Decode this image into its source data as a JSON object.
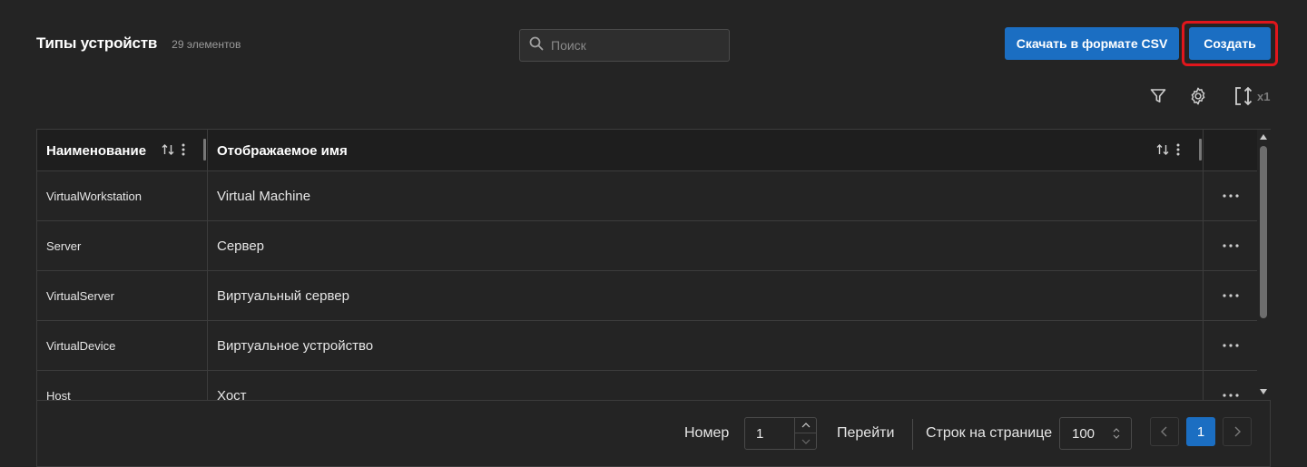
{
  "header": {
    "title": "Типы устройств",
    "count": "29 элементов",
    "search_placeholder": "Поиск",
    "csv_button": "Скачать в формате CSV",
    "create_button": "Создать"
  },
  "toolbar": {
    "filter_icon": "filter-icon",
    "settings_icon": "gear-icon",
    "density_icon": "row-height-icon",
    "density_label": "x1"
  },
  "table": {
    "columns": [
      {
        "label": "Наименование"
      },
      {
        "label": "Отображаемое имя"
      }
    ],
    "rows": [
      {
        "name": "VirtualWorkstation",
        "display": "Virtual Machine"
      },
      {
        "name": "Server",
        "display": "Сервер"
      },
      {
        "name": "VirtualServer",
        "display": "Виртуальный сервер"
      },
      {
        "name": "VirtualDevice",
        "display": "Виртуальное устройство"
      },
      {
        "name": "Host",
        "display": "Хост"
      }
    ]
  },
  "pagination": {
    "number_label": "Номер",
    "page_value": "1",
    "go_button": "Перейти",
    "rows_label": "Строк на странице",
    "rows_value": "100",
    "current_page": "1"
  },
  "colors": {
    "accent": "#1b6ec2",
    "highlight": "#e0161c",
    "background": "#242424"
  }
}
